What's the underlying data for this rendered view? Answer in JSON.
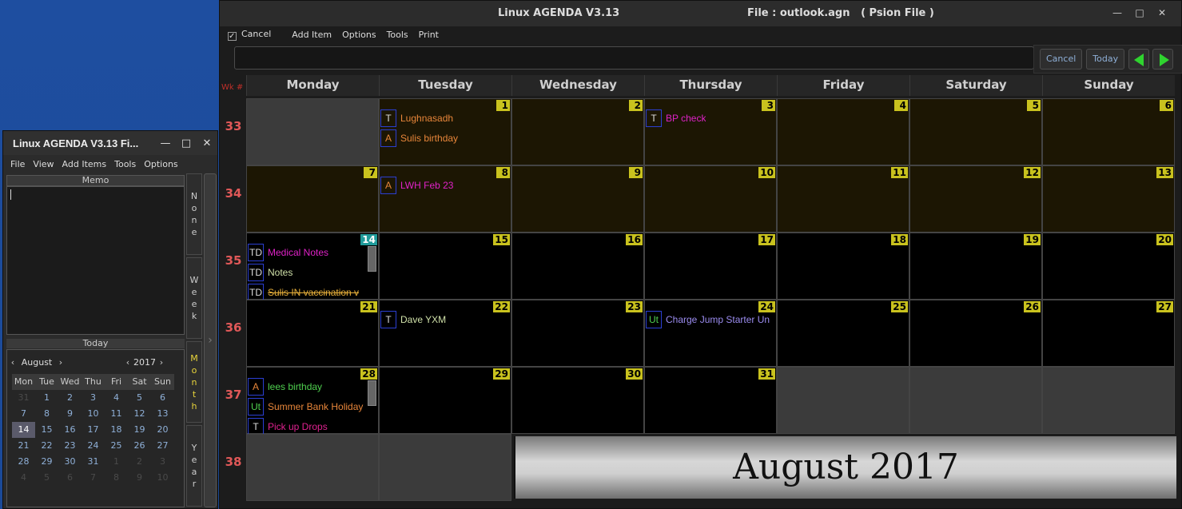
{
  "small_window": {
    "title": "Linux AGENDA V3.13  Fi...",
    "controls": [
      "—",
      "□",
      "✕"
    ],
    "menu": [
      "File",
      "View",
      "Add Items",
      "Tools",
      "Options"
    ],
    "memo_label": "Memo",
    "today_label": "Today",
    "month_label": "August",
    "year_label": "2017",
    "weekdays": [
      "Mon",
      "Tue",
      "Wed",
      "Thu",
      "Fri",
      "Sat",
      "Sun"
    ],
    "days": [
      [
        "31",
        "1",
        "2",
        "3",
        "4",
        "5",
        "6"
      ],
      [
        "7",
        "8",
        "9",
        "10",
        "11",
        "12",
        "13"
      ],
      [
        "14",
        "15",
        "16",
        "17",
        "18",
        "19",
        "20"
      ],
      [
        "21",
        "22",
        "23",
        "24",
        "25",
        "26",
        "27"
      ],
      [
        "28",
        "29",
        "30",
        "31",
        "1",
        "2",
        "3"
      ],
      [
        "4",
        "5",
        "6",
        "7",
        "8",
        "9",
        "10"
      ]
    ],
    "view_buttons": [
      "None",
      "Week",
      "Month",
      "Year"
    ],
    "active_view": "Month"
  },
  "main_window": {
    "title_app": "Linux AGENDA V3.13",
    "title_file": "File : outlook.agn   ( Psion File )",
    "controls": [
      "—",
      "□",
      "✕"
    ],
    "menu_cancel": "Cancel",
    "menu": [
      "Add Item",
      "Options",
      "Tools",
      "Print"
    ],
    "buttons": {
      "cancel": "Cancel",
      "today": "Today"
    },
    "wk_label": "Wk #",
    "day_headers": [
      "Monday",
      "Tuesday",
      "Wednesday",
      "Thursday",
      "Friday",
      "Saturday",
      "Sunday"
    ],
    "weeks": [
      {
        "num": "33",
        "days": [
          {
            "d": "",
            "shade": "grey",
            "events": []
          },
          {
            "d": "1",
            "shade": "bright",
            "events": [
              {
                "tag": "T",
                "text": "Lughnasadh",
                "color": "#e8863a"
              },
              {
                "tag": "A",
                "text": "Sulis birthday",
                "color": "#e8863a",
                "tag_color": "#e8863a"
              }
            ]
          },
          {
            "d": "2",
            "shade": "bright",
            "events": []
          },
          {
            "d": "3",
            "shade": "bright",
            "events": [
              {
                "tag": "T",
                "text": "BP check",
                "color": "#e022c8"
              }
            ]
          },
          {
            "d": "4",
            "shade": "bright",
            "events": []
          },
          {
            "d": "5",
            "shade": "bright",
            "events": []
          },
          {
            "d": "6",
            "shade": "bright",
            "events": []
          }
        ]
      },
      {
        "num": "34",
        "days": [
          {
            "d": "7",
            "shade": "bright",
            "events": []
          },
          {
            "d": "8",
            "shade": "bright",
            "events": [
              {
                "tag": "A",
                "text": "LWH Feb 23",
                "color": "#e022c8",
                "tag_color": "#e8863a"
              }
            ]
          },
          {
            "d": "9",
            "shade": "bright",
            "events": []
          },
          {
            "d": "10",
            "shade": "bright",
            "events": []
          },
          {
            "d": "11",
            "shade": "bright",
            "events": []
          },
          {
            "d": "12",
            "shade": "bright",
            "events": []
          },
          {
            "d": "13",
            "shade": "bright",
            "events": []
          }
        ]
      },
      {
        "num": "35",
        "days": [
          {
            "d": "14",
            "shade": "dark",
            "today": true,
            "scroll": true,
            "events": [
              {
                "tag": "TD",
                "text": "Medical Notes",
                "color": "#e022c8"
              },
              {
                "tag": "TD",
                "text": "Notes",
                "color": "#cfe0a8"
              },
              {
                "tag": "TD",
                "text": "Sulis IN vaccination v",
                "color": "#e8b03a",
                "strike": true
              }
            ]
          },
          {
            "d": "15",
            "shade": "dark",
            "events": []
          },
          {
            "d": "16",
            "shade": "dark",
            "events": []
          },
          {
            "d": "17",
            "shade": "dark",
            "events": []
          },
          {
            "d": "18",
            "shade": "dark",
            "events": []
          },
          {
            "d": "19",
            "shade": "dark",
            "events": []
          },
          {
            "d": "20",
            "shade": "dark",
            "events": []
          }
        ]
      },
      {
        "num": "36",
        "days": [
          {
            "d": "21",
            "shade": "dark",
            "events": []
          },
          {
            "d": "22",
            "shade": "dark",
            "events": [
              {
                "tag": "T",
                "text": "Dave YXM",
                "color": "#cfe0a8"
              }
            ]
          },
          {
            "d": "23",
            "shade": "dark",
            "events": []
          },
          {
            "d": "24",
            "shade": "dark",
            "events": [
              {
                "tag": "Ut",
                "text": "Charge Jump Starter Un",
                "color": "#9b8cf0",
                "tag_color": "#4fd04f"
              }
            ]
          },
          {
            "d": "25",
            "shade": "dark",
            "events": []
          },
          {
            "d": "26",
            "shade": "dark",
            "events": []
          },
          {
            "d": "27",
            "shade": "dark",
            "events": []
          }
        ]
      },
      {
        "num": "37",
        "days": [
          {
            "d": "28",
            "shade": "dark",
            "scroll": true,
            "events": [
              {
                "tag": "A",
                "text": "lees birthday",
                "color": "#4fd04f",
                "tag_color": "#e8863a"
              },
              {
                "tag": "Ut",
                "text": "Summer Bank Holiday",
                "color": "#e8863a",
                "tag_color": "#4fd04f"
              },
              {
                "tag": "T",
                "text": "Pick up Drops",
                "color": "#e02290"
              }
            ]
          },
          {
            "d": "29",
            "shade": "dark",
            "events": []
          },
          {
            "d": "30",
            "shade": "dark",
            "events": []
          },
          {
            "d": "31",
            "shade": "dark",
            "events": []
          },
          {
            "d": "",
            "shade": "grey",
            "events": []
          },
          {
            "d": "",
            "shade": "grey",
            "events": []
          },
          {
            "d": "",
            "shade": "grey",
            "events": []
          }
        ]
      },
      {
        "num": "38",
        "days": [
          {
            "d": "",
            "shade": "grey",
            "events": []
          },
          {
            "d": "",
            "shade": "grey",
            "events": []
          }
        ]
      }
    ],
    "banner": "August 2017"
  }
}
